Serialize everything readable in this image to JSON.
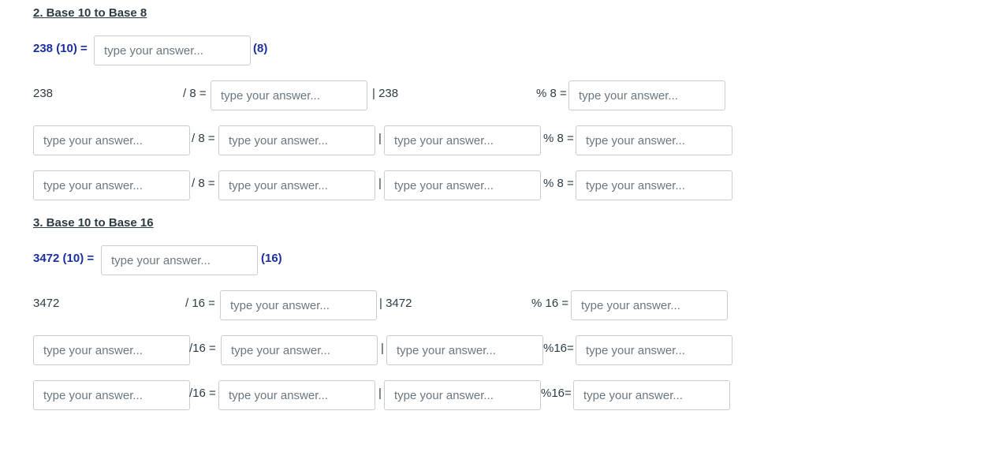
{
  "placeholder": "type your answer...",
  "section2": {
    "heading": "2. Base 10 to Base 8",
    "prompt_left": "238 (10) =",
    "prompt_right": "(8)",
    "row1": {
      "number": "238",
      "div": "/ 8 =",
      "bar_num": "| 238",
      "mod": "% 8 ="
    },
    "row2": {
      "div": "/ 8 =",
      "bar": "|",
      "mod": "% 8 ="
    },
    "row3": {
      "div": "/ 8 =",
      "bar": "|",
      "mod": "% 8 ="
    }
  },
  "section3": {
    "heading": "3. Base 10 to Base 16",
    "prompt_left": "3472 (10) =",
    "prompt_right": "(16)",
    "row1": {
      "number": "3472",
      "div": "/ 16 =",
      "bar_num": "| 3472",
      "mod": "% 16 ="
    },
    "row2": {
      "div": "/16 =",
      "bar": "|",
      "mod": "%16="
    },
    "row3": {
      "div": "/16 =",
      "bar": "|",
      "mod": "%16="
    }
  }
}
